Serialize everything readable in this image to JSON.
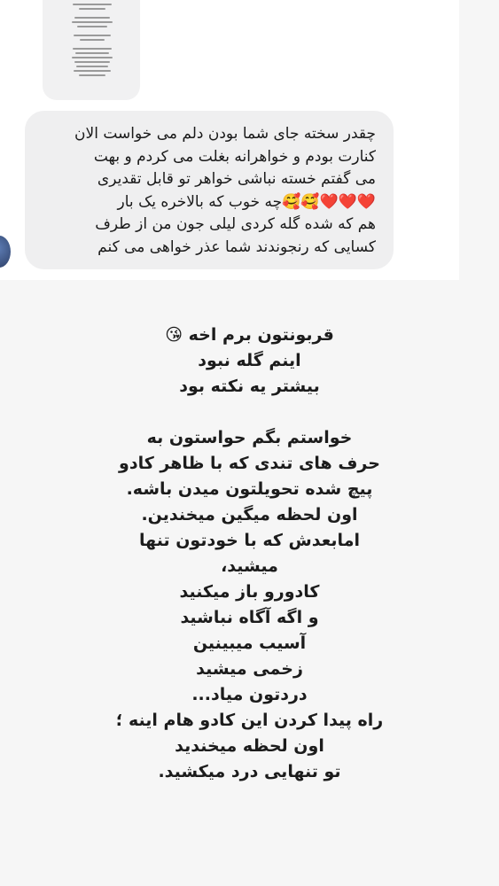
{
  "message": {
    "lines": [
      "چقدر سخته جای شما بودن دلم می خواست الان",
      "کنارت بودم و خواهرانه بغلت می کردم و بهت",
      "می گفتم خسته نباشی خواهر  تو قابل تقدیری",
      "❤️❤️❤️🥰🥰چه خوب که بالاخره یک بار",
      "هم که شده گله کردی لیلی جون من از طرف",
      "کسایی که رنجوندند شما عذر خواهی می کنم"
    ]
  },
  "story": {
    "lines": [
      "قربونتون برم اخه 😘",
      "اینم گله نبود",
      "بیشتر یه نکته بود",
      "",
      "خواستم بگم حواستون به",
      "حرف های تندی که با ظاهر کادو",
      "پیچ شده تحویلتون میدن باشه.",
      "اون لحظه میگین میخندین.",
      "امابعدش که با خودتون تنها",
      "میشید،",
      "کادورو باز میکنید",
      "و اگه آگاه نباشید",
      "آسیب میبینین",
      "زخمی میشید",
      "دردتون میاد...",
      "راه پیدا کردن این کادو هام اینه ؛",
      "اون لحظه میخندید",
      "تو تنهایی درد میکشید."
    ]
  }
}
